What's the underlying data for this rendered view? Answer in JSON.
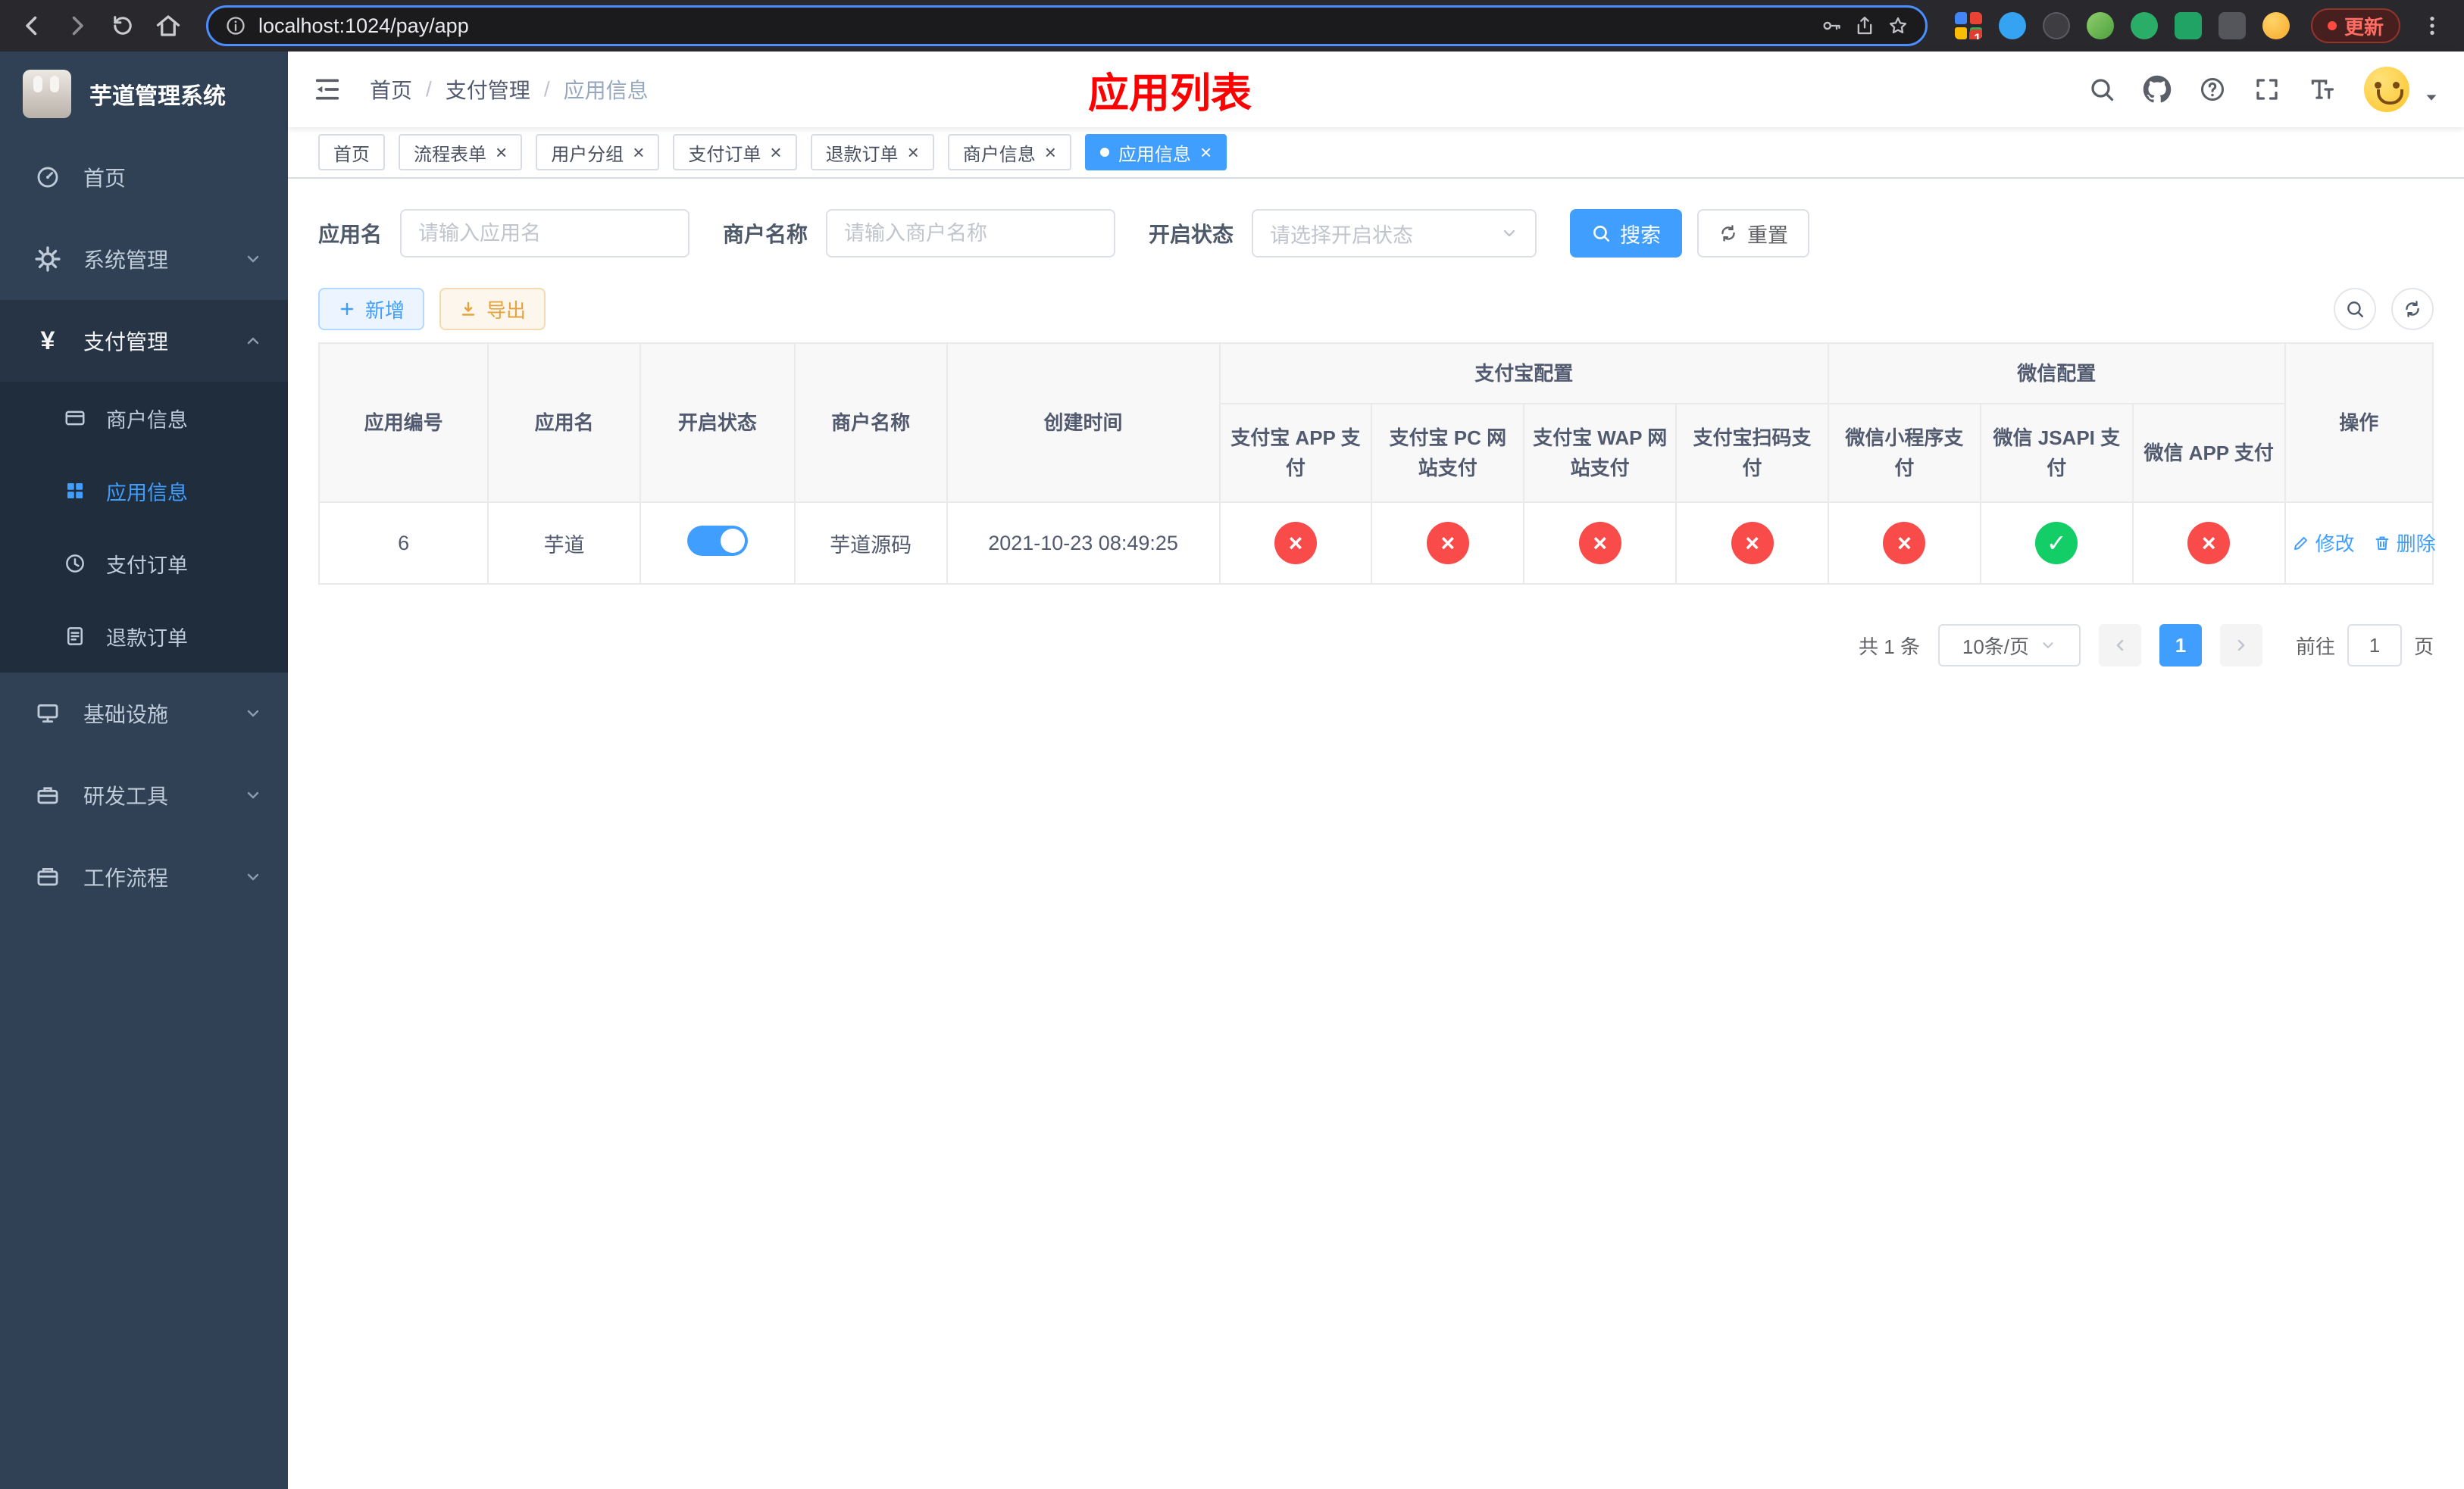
{
  "colors": {
    "primary": "#409eff",
    "success": "#13ce66",
    "danger": "#fa4b4b",
    "warning": "#e6a23c",
    "page_title_red": "#ff0000",
    "sidebar_bg": "#304156",
    "submenu_bg": "#1f2d3d"
  },
  "browser": {
    "url": "localhost:1024/pay/app",
    "update_label": "更新",
    "extensions_badge": "10"
  },
  "sidebar": {
    "app_title": "芋道管理系统",
    "menu": [
      {
        "label": "首页"
      },
      {
        "label": "系统管理"
      },
      {
        "label": "支付管理"
      },
      {
        "label": "基础设施"
      },
      {
        "label": "研发工具"
      },
      {
        "label": "工作流程"
      }
    ],
    "payment_children": [
      {
        "label": "商户信息"
      },
      {
        "label": "应用信息"
      },
      {
        "label": "支付订单"
      },
      {
        "label": "退款订单"
      }
    ]
  },
  "header": {
    "breadcrumb": [
      "首页",
      "支付管理",
      "应用信息"
    ],
    "page_title": "应用列表"
  },
  "tabs": [
    {
      "label": "首页"
    },
    {
      "label": "流程表单"
    },
    {
      "label": "用户分组"
    },
    {
      "label": "支付订单"
    },
    {
      "label": "退款订单"
    },
    {
      "label": "商户信息"
    },
    {
      "label": "应用信息"
    }
  ],
  "filters": {
    "app_name_label": "应用名",
    "app_name_placeholder": "请输入应用名",
    "merchant_label": "商户名称",
    "merchant_placeholder": "请输入商户名称",
    "status_label": "开启状态",
    "status_placeholder": "请选择开启状态",
    "search_label": "搜索",
    "reset_label": "重置"
  },
  "toolbar": {
    "add_label": "新增",
    "export_label": "导出"
  },
  "table": {
    "groups": {
      "alipay": "支付宝配置",
      "wechat": "微信配置"
    },
    "columns": {
      "id": "应用编号",
      "name": "应用名",
      "status": "开启状态",
      "merchant": "商户名称",
      "created": "创建时间",
      "actions": "操作"
    },
    "sub_columns": [
      "支付宝 APP 支付",
      "支付宝 PC 网站支付",
      "支付宝 WAP 网站支付",
      "支付宝扫码支付",
      "微信小程序支付",
      "微信 JSAPI 支付",
      "微信 APP 支付"
    ],
    "row": {
      "id": "6",
      "name": "芋道",
      "status_on": true,
      "merchant": "芋道源码",
      "created": "2021-10-23 08:49:25",
      "configs": [
        false,
        false,
        false,
        false,
        false,
        true,
        false
      ],
      "edit_label": "修改",
      "delete_label": "删除"
    }
  },
  "pagination": {
    "total": "共 1 条",
    "page_size": "10条/页",
    "current_page": "1",
    "goto_prefix": "前往",
    "goto_value": "1",
    "goto_suffix": "页"
  }
}
